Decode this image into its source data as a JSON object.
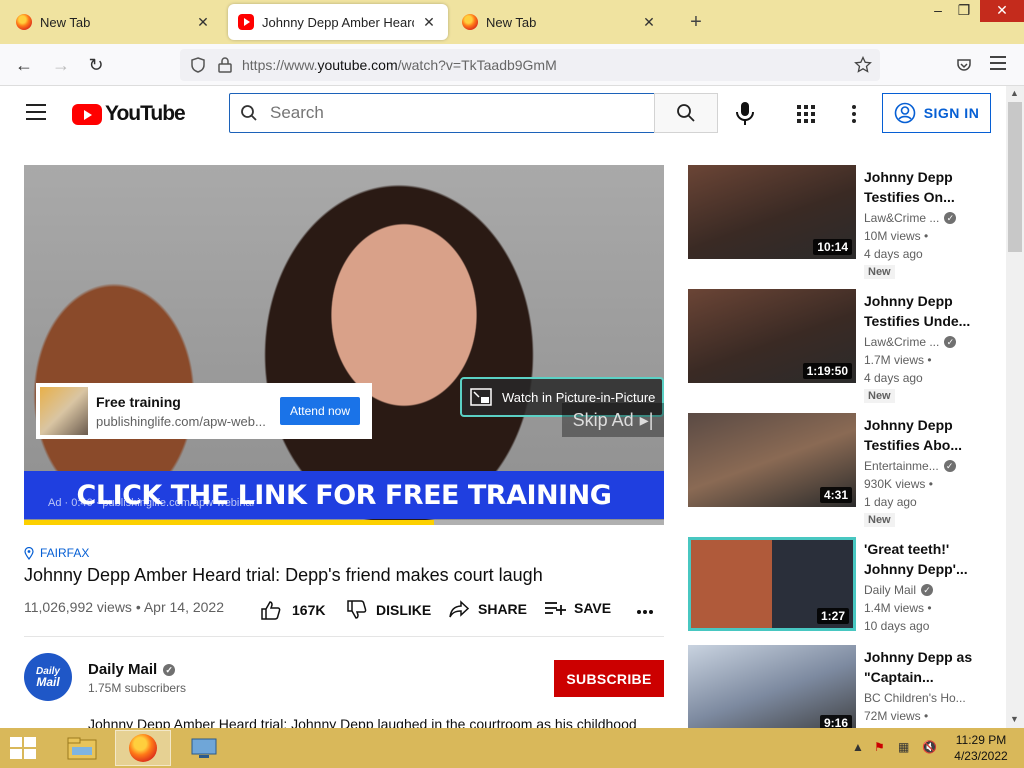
{
  "browser": {
    "tabs": [
      {
        "title": "New Tab",
        "icon": "firefox-icon"
      },
      {
        "title": "Johnny Depp Amber Heard trial",
        "icon": "youtube-icon"
      },
      {
        "title": "New Tab",
        "icon": "firefox-icon"
      }
    ],
    "url_prefix": "https://www.",
    "url_domain": "youtube.com",
    "url_path": "/watch?v=TkTaadb9GmM"
  },
  "header": {
    "logo_text": "YouTube",
    "search_placeholder": "Search",
    "signin_label": "SIGN IN"
  },
  "player": {
    "ad_card_title": "Free training",
    "ad_card_url": "publishinglife.com/apw-web...",
    "ad_card_button": "Attend now",
    "pip_label": "Watch in Picture-in-Picture",
    "skip_label": "Skip Ad",
    "banner_text": "CLICK THE LINK FOR FREE TRAINING",
    "ad_info": "Ad · 0:46 · publishinglife.com/apw-webinar",
    "ad_progress": 0.64
  },
  "video": {
    "location": "FAIRFAX",
    "title": "Johnny Depp Amber Heard trial: Depp's friend makes court laugh",
    "stats": "11,026,992 views • Apr 14, 2022",
    "likes": "167K",
    "dislike_label": "DISLIKE",
    "share_label": "SHARE",
    "save_label": "SAVE"
  },
  "channel": {
    "avatar_line1": "Daily",
    "avatar_line2": "Mail",
    "name": "Daily Mail",
    "subscribers": "1.75M subscribers",
    "subscribe_label": "SUBSCRIBE",
    "description": "Johnny Depp Amber Heard trial: Johnny Depp laughed in the courtroom as his childhood"
  },
  "related": [
    {
      "title": "Johnny Depp Testifies On...",
      "channel": "Law&Crime ...",
      "views": "10M views •",
      "age": "4 days ago",
      "badge": "New",
      "duration": "10:14"
    },
    {
      "title": "Johnny Depp Testifies Unde...",
      "channel": "Law&Crime ...",
      "views": "1.7M views •",
      "age": "4 days ago",
      "badge": "New",
      "duration": "1:19:50"
    },
    {
      "title": "Johnny Depp Testifies Abo...",
      "channel": "Entertainme...",
      "views": "930K views •",
      "age": "1 day ago",
      "badge": "New",
      "duration": "4:31"
    },
    {
      "title": "'Great teeth!' Johnny Depp'...",
      "channel": "Daily Mail",
      "views": "1.4M views •",
      "age": "10 days ago",
      "badge": "",
      "duration": "1:27"
    },
    {
      "title": "Johnny Depp as \"Captain...",
      "channel": "BC Children's Ho...",
      "views": "72M views •",
      "age": "",
      "badge": "",
      "duration": "9:16"
    }
  ],
  "taskbar": {
    "time": "11:29 PM",
    "date": "4/23/2022"
  },
  "colors": {
    "tabstrip": "#f0e3a0",
    "taskbar": "#d9b85a",
    "yt_red": "#ff0000",
    "subscribe": "#cc0000",
    "link_blue": "#065fd4"
  }
}
